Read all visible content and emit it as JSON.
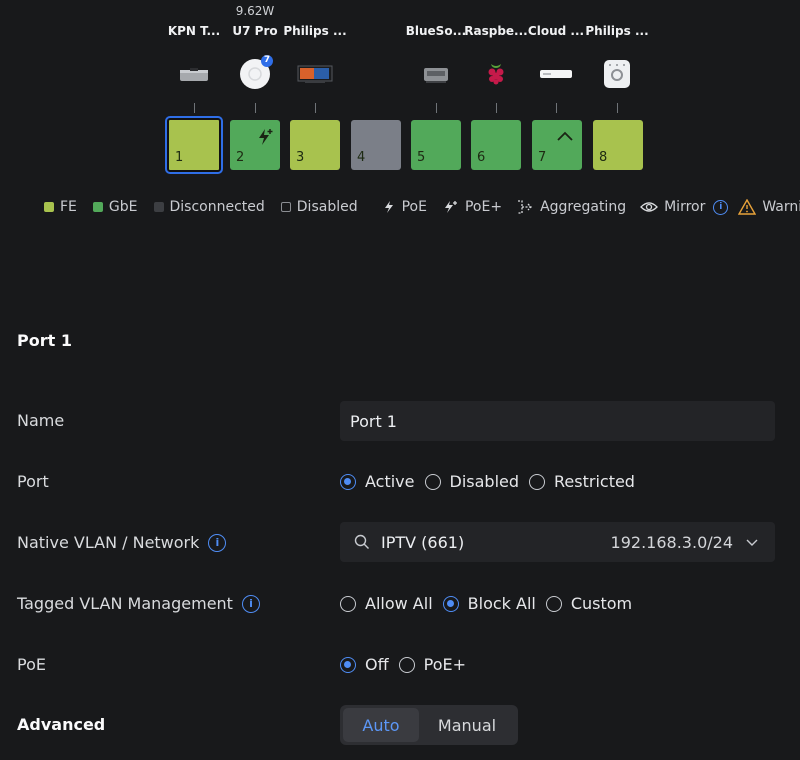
{
  "devices": [
    {
      "port": "1",
      "label": "KPN T...",
      "icon": "tv-box-icon"
    },
    {
      "port": "2",
      "label": "U7 Pro",
      "power": "9.62W",
      "badge": "7",
      "icon": "access-point-icon"
    },
    {
      "port": "3",
      "label": "Philips ...",
      "icon": "tv-icon"
    },
    {
      "port": "5",
      "label": "BlueSo...",
      "icon": "audio-device-icon"
    },
    {
      "port": "6",
      "label": "Raspbe...",
      "icon": "raspberry-pi-icon"
    },
    {
      "port": "7",
      "label": "Cloud ...",
      "icon": "cloud-gateway-icon"
    },
    {
      "port": "8",
      "label": "Philips ...",
      "icon": "hue-bridge-icon"
    }
  ],
  "ports": [
    {
      "number": "1",
      "speed": "FE"
    },
    {
      "number": "2",
      "speed": "GbE",
      "poe": "PoE+"
    },
    {
      "number": "3",
      "speed": "FE"
    },
    {
      "number": "4",
      "speed": "Disconnected"
    },
    {
      "number": "5",
      "speed": "GbE"
    },
    {
      "number": "6",
      "speed": "GbE"
    },
    {
      "number": "7",
      "speed": "GbE",
      "uplink": true
    },
    {
      "number": "8",
      "speed": "FE"
    }
  ],
  "legend": {
    "fe": "FE",
    "gbe": "GbE",
    "disconnected": "Disconnected",
    "disabled": "Disabled",
    "poe": "PoE",
    "poe_plus": "PoE+",
    "aggregating": "Aggregating",
    "mirror": "Mirror",
    "warning": "Warning"
  },
  "colors": {
    "fe": "#a8c24e",
    "gbe": "#52a95a",
    "disconnected": "#7b7f88",
    "accent": "#4f8df5",
    "warning": "#e8a23a"
  },
  "section_title": "Port 1",
  "form": {
    "name": {
      "label": "Name",
      "value": "Port 1"
    },
    "port": {
      "label": "Port",
      "options": [
        "Active",
        "Disabled",
        "Restricted"
      ],
      "selected": "Active"
    },
    "native_vlan": {
      "label": "Native VLAN / Network",
      "value": "IPTV (661)",
      "subnet": "192.168.3.0/24"
    },
    "tagged_vlan": {
      "label": "Tagged VLAN Management",
      "options": [
        "Allow All",
        "Block All",
        "Custom"
      ],
      "selected": "Block All"
    },
    "poe": {
      "label": "PoE",
      "options": [
        "Off",
        "PoE+"
      ],
      "selected": "Off"
    },
    "advanced": {
      "label": "Advanced",
      "options": [
        "Auto",
        "Manual"
      ],
      "selected": "Auto"
    }
  }
}
